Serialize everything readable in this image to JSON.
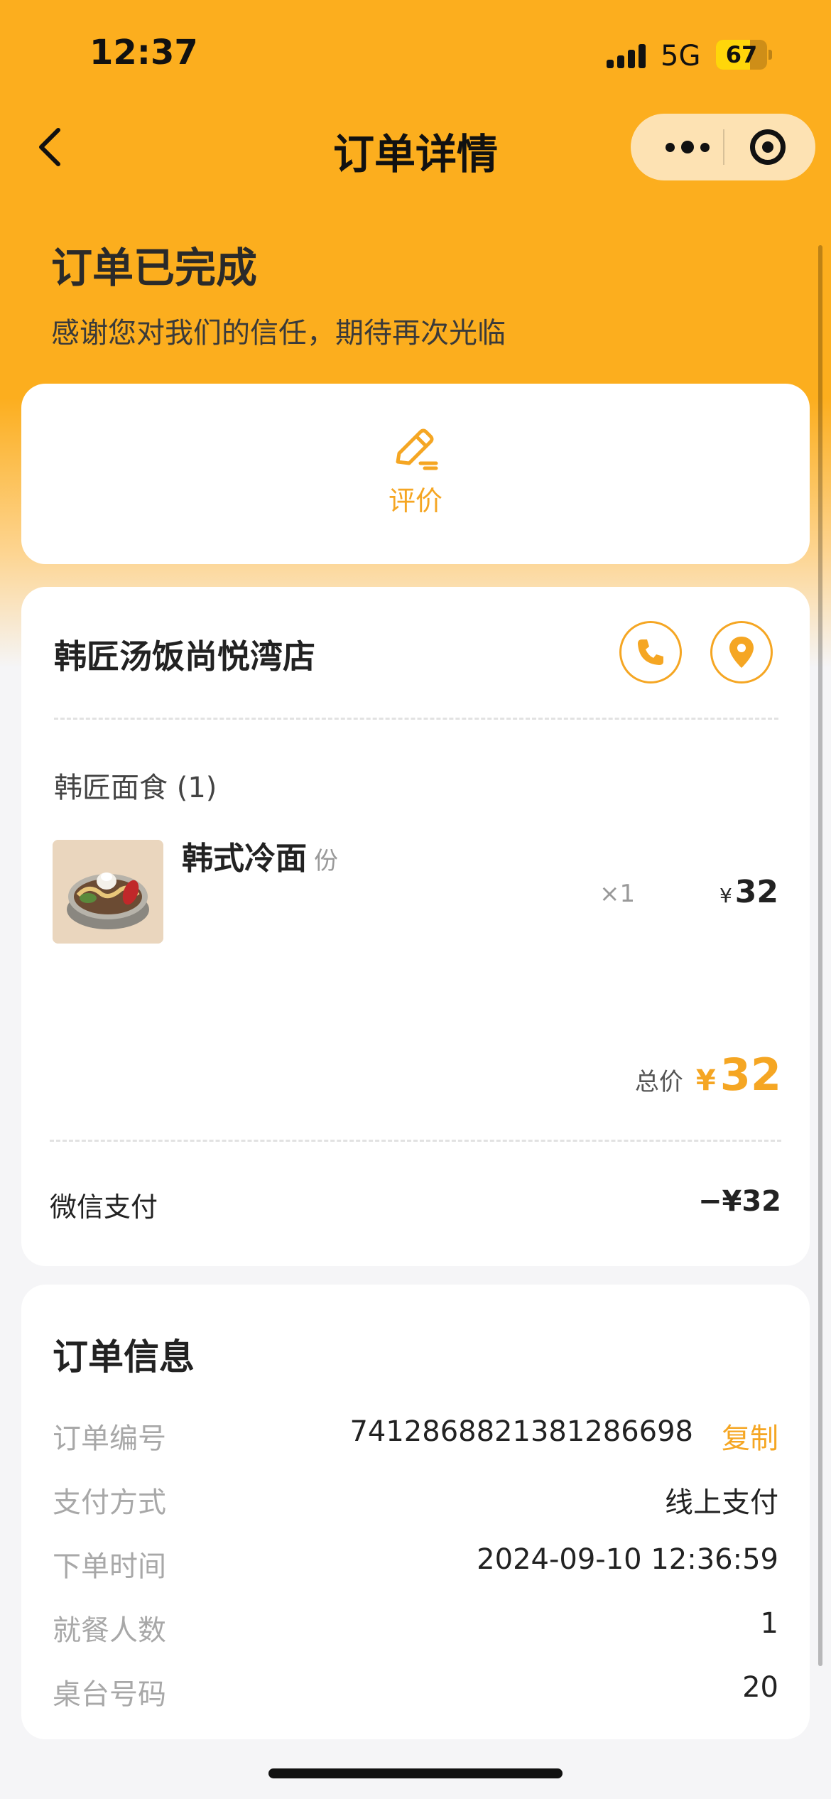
{
  "status_bar": {
    "time": "12:37",
    "network": "5G",
    "battery": "67",
    "battery_level": 0.67
  },
  "nav": {
    "title": "订单详情",
    "back_icon": "chevron-left-icon",
    "more_icon": "more-dots-icon",
    "close_icon": "target-icon"
  },
  "order_status": {
    "title": "订单已完成",
    "subtitle": "感谢您对我们的信任，期待再次光临"
  },
  "review": {
    "label": "评价",
    "icon": "edit-pen-icon"
  },
  "store": {
    "name": "韩匠汤饭尚悦湾店",
    "call_icon": "phone-icon",
    "location_icon": "location-pin-icon",
    "category": "韩匠面食 (1)",
    "items": [
      {
        "name": "韩式冷面",
        "unit": "份",
        "qty": "×1",
        "currency": "¥",
        "price": "32"
      }
    ],
    "total_label": "总价",
    "total_currency": "¥",
    "total_amount": "32",
    "payment_label": "微信支付",
    "payment_value": "−¥32"
  },
  "order_info": {
    "title": "订单信息",
    "rows": [
      {
        "label": "订单编号",
        "value": "7412868821381286698",
        "action": "复制"
      },
      {
        "label": "支付方式",
        "value": "线上支付"
      },
      {
        "label": "下单时间",
        "value": "2024-09-10 12:36:59"
      },
      {
        "label": "就餐人数",
        "value": "1"
      },
      {
        "label": "桌台号码",
        "value": "20"
      }
    ]
  },
  "colors": {
    "brand": "#fcae1e",
    "accent": "#f5a623",
    "background": "#f5f5f7"
  }
}
